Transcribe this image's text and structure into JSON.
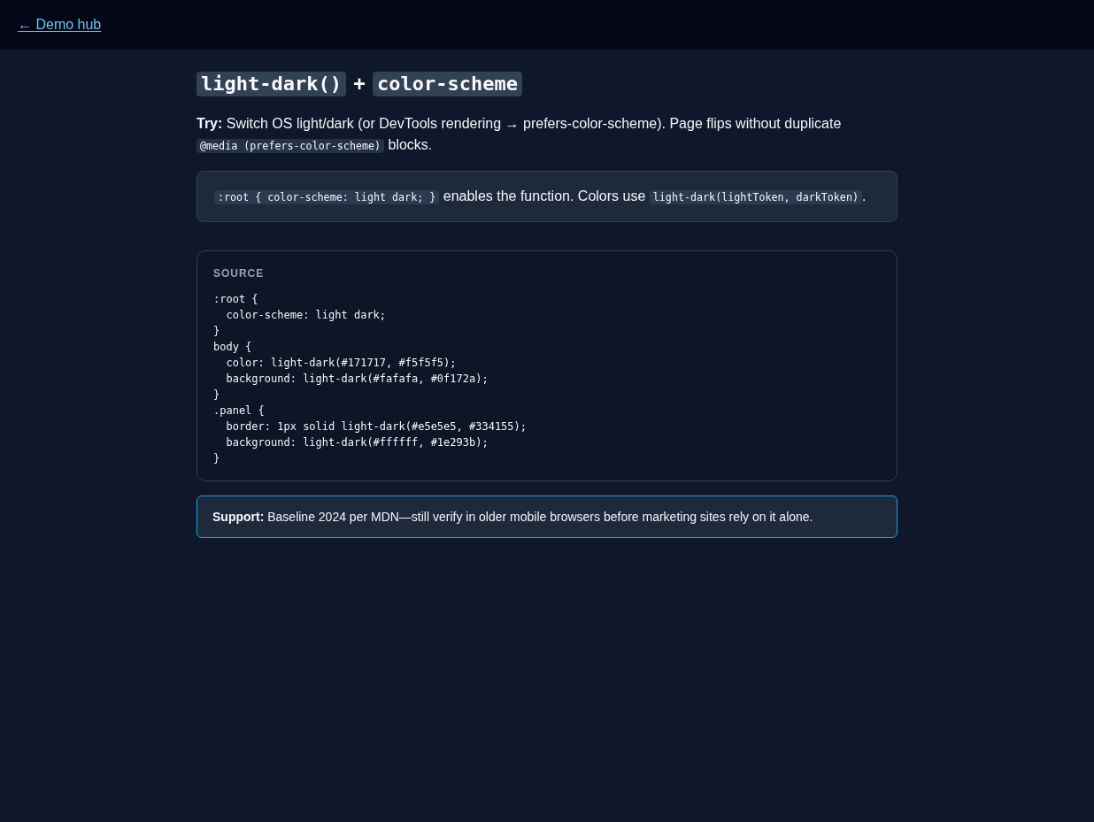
{
  "nav": {
    "back_link": "← Demo hub"
  },
  "title": [
    {
      "kind": "code",
      "text": "light-dark()"
    },
    {
      "kind": "text",
      "text": "+"
    },
    {
      "kind": "code",
      "text": "color-scheme"
    }
  ],
  "intro": [
    {
      "kind": "text",
      "text": "**Try:** Switch OS light/dark (or DevTools rendering → prefers-color-scheme). Page flips without duplicate "
    },
    {
      "kind": "code",
      "text": "@media (prefers-color-scheme)"
    },
    {
      "kind": "text",
      "text": " blocks."
    }
  ],
  "note": [
    {
      "kind": "code",
      "text": ":root { color-scheme: light dark; }"
    },
    {
      "kind": "text",
      "text": " enables the function. Colors use "
    },
    {
      "kind": "code",
      "text": "light-dark(lightToken, darkToken)"
    },
    {
      "kind": "text",
      "text": "."
    }
  ],
  "source": {
    "label": "SOURCE",
    "code_lines": [
      ":root {",
      "  color-scheme: light dark;",
      "}",
      "body {",
      "  color: light-dark(#171717, #f5f5f5);",
      "  background: light-dark(#fafafa, #0f172a);",
      "}",
      ".panel {",
      "  border: 1px solid light-dark(#e5e5e5, #334155);",
      "  background: light-dark(#ffffff, #1e293b);",
      "}"
    ]
  },
  "support": "**Support:** Baseline 2024 per MDN—still verify in older mobile browsers before marketing sites rely on it alone."
}
